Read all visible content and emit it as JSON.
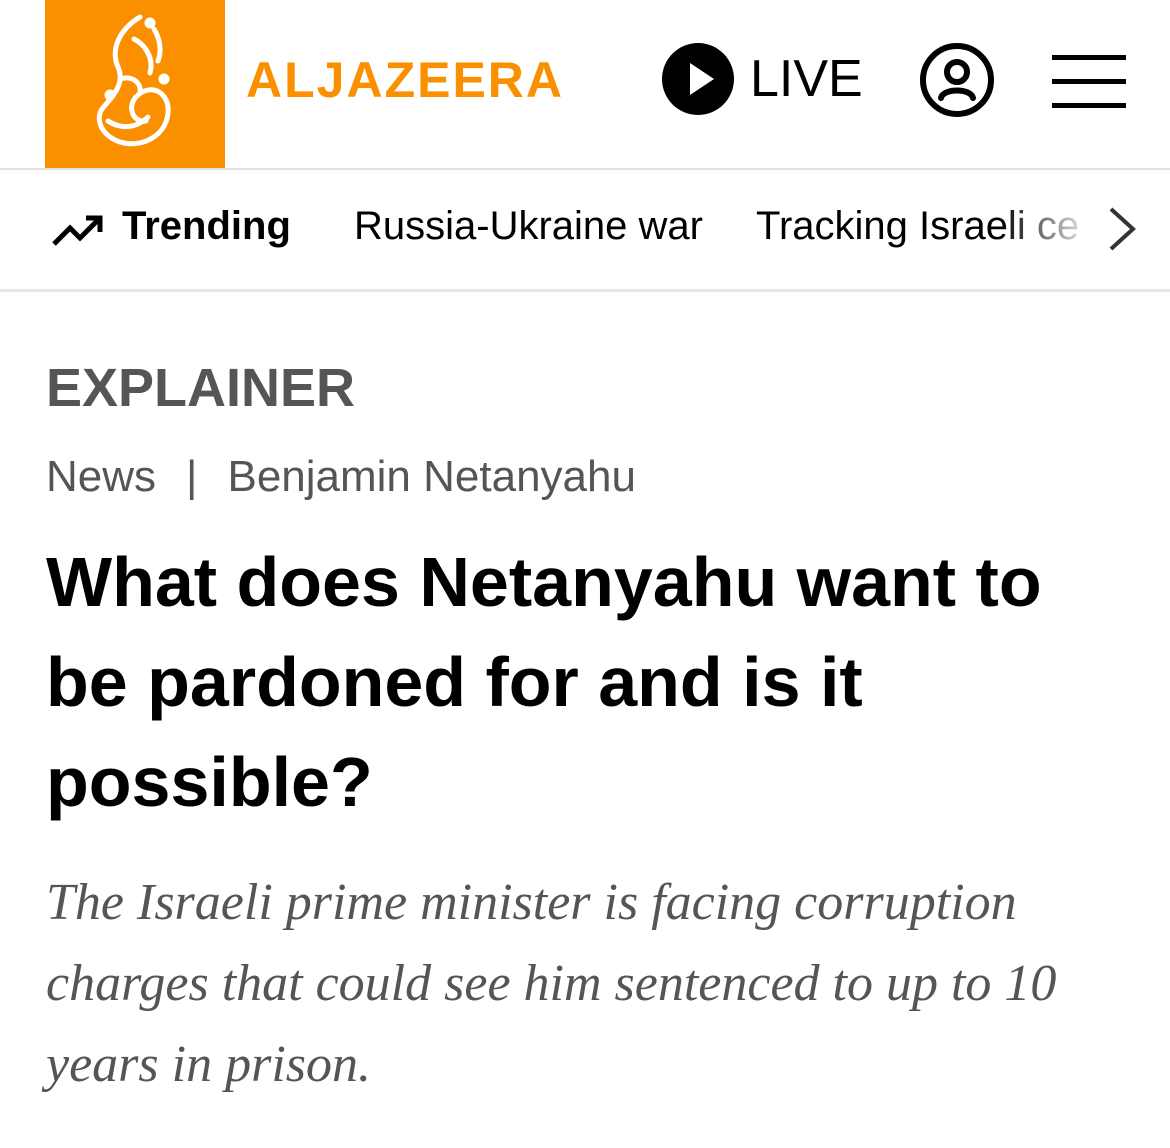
{
  "header": {
    "logo_alt": "Al Jazeera logo",
    "logo_icon": "aljazeera-calligraphy-logo",
    "brand_name": "ALJAZEERA",
    "live_label": "LIVE",
    "live_icon": "play-circle-icon",
    "account_icon": "account-icon",
    "menu_icon": "hamburger-menu-icon",
    "brand_color": "#fa9000"
  },
  "trending": {
    "icon": "trending-up-icon",
    "label": "Trending",
    "links": [
      "Russia-Ukraine war",
      "Tracking Israeli ce"
    ],
    "scroll_icon": "chevron-right-icon"
  },
  "article": {
    "kicker": "EXPLAINER",
    "breadcrumb": {
      "section": "News",
      "separator": "|",
      "topic": "Benjamin Netanyahu"
    },
    "headline": "What does Netanyahu want to be pardoned for and is it possible?",
    "standfirst": "The Israeli prime minister is facing corruption charges that could see him sentenced to up to 10 years in prison."
  }
}
